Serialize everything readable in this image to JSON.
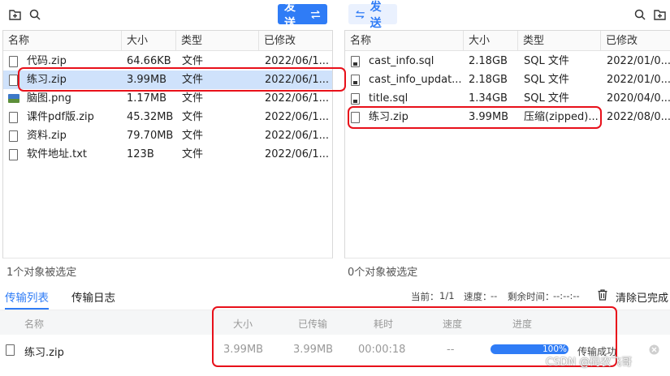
{
  "toolbar_left": {
    "add_icon": "new-folder-icon",
    "search_icon": "search-icon",
    "send_label": "发送",
    "send_icon": "transfer-arrows-icon"
  },
  "toolbar_right": {
    "send_label": "发送",
    "send_icon": "transfer-arrows-icon",
    "search_icon": "search-icon",
    "add_icon": "new-folder-icon"
  },
  "local_panel": {
    "columns": [
      "名称",
      "大小",
      "类型",
      "已修改"
    ],
    "rows": [
      {
        "name": "代码.zip",
        "size": "64.66KB",
        "type": "文件",
        "modified": "2022/06/1...",
        "icon": "file-icon"
      },
      {
        "name": "练习.zip",
        "size": "3.99MB",
        "type": "文件",
        "modified": "2022/06/1...",
        "icon": "file-icon",
        "selected": true
      },
      {
        "name": "脑图.png",
        "size": "1.17MB",
        "type": "文件",
        "modified": "2022/06/1...",
        "icon": "image-icon"
      },
      {
        "name": "课件pdf版.zip",
        "size": "45.32MB",
        "type": "文件",
        "modified": "2022/06/1...",
        "icon": "file-icon"
      },
      {
        "name": "资料.zip",
        "size": "79.70MB",
        "type": "文件",
        "modified": "2022/06/1...",
        "icon": "file-icon"
      },
      {
        "name": "软件地址.txt",
        "size": "123B",
        "type": "文件",
        "modified": "2022/06/1...",
        "icon": "file-icon"
      }
    ],
    "status": "1个对象被选定"
  },
  "remote_panel": {
    "columns": [
      "名称",
      "大小",
      "类型",
      "已修改"
    ],
    "rows": [
      {
        "name": "cast_info.sql",
        "size": "2.18GB",
        "type": "SQL 文件",
        "modified": "2022/01/0...",
        "icon": "sql-file-icon"
      },
      {
        "name": "cast_info_updat...",
        "size": "2.18GB",
        "type": "SQL 文件",
        "modified": "2022/01/0...",
        "icon": "sql-file-icon"
      },
      {
        "name": "title.sql",
        "size": "1.34GB",
        "type": "SQL 文件",
        "modified": "2020/04/0...",
        "icon": "sql-file-icon"
      },
      {
        "name": "练习.zip",
        "size": "3.99MB",
        "type": "压缩(zipped)...",
        "modified": "2022/08/0...",
        "icon": "file-icon"
      }
    ],
    "status": "0个对象被选定"
  },
  "transfer": {
    "tabs": [
      "传输列表",
      "传输日志"
    ],
    "current_label": "当前：",
    "current_value": "1/1",
    "speed_label": "速度：",
    "speed_value": "--",
    "remaining_label": "剩余时间：",
    "remaining_value": "--:--:--",
    "clear_label": "清除已完成",
    "clear_icon": "trash-icon",
    "columns": [
      "名称",
      "大小",
      "已传输",
      "耗时",
      "速度",
      "进度"
    ],
    "item": {
      "name": "练习.zip",
      "size": "3.99MB",
      "transferred": "3.99MB",
      "elapsed": "00:00:18",
      "speed": "--",
      "progress": 1.0,
      "progress_label": "100%",
      "state": "传输成功",
      "close_icon": "close-circle-icon"
    }
  },
  "watermark": "CSDN @码农飞哥",
  "colors": {
    "accent": "#2f7cf6",
    "selection": "#cfe2fb",
    "highlight_box": "#e8101a"
  }
}
